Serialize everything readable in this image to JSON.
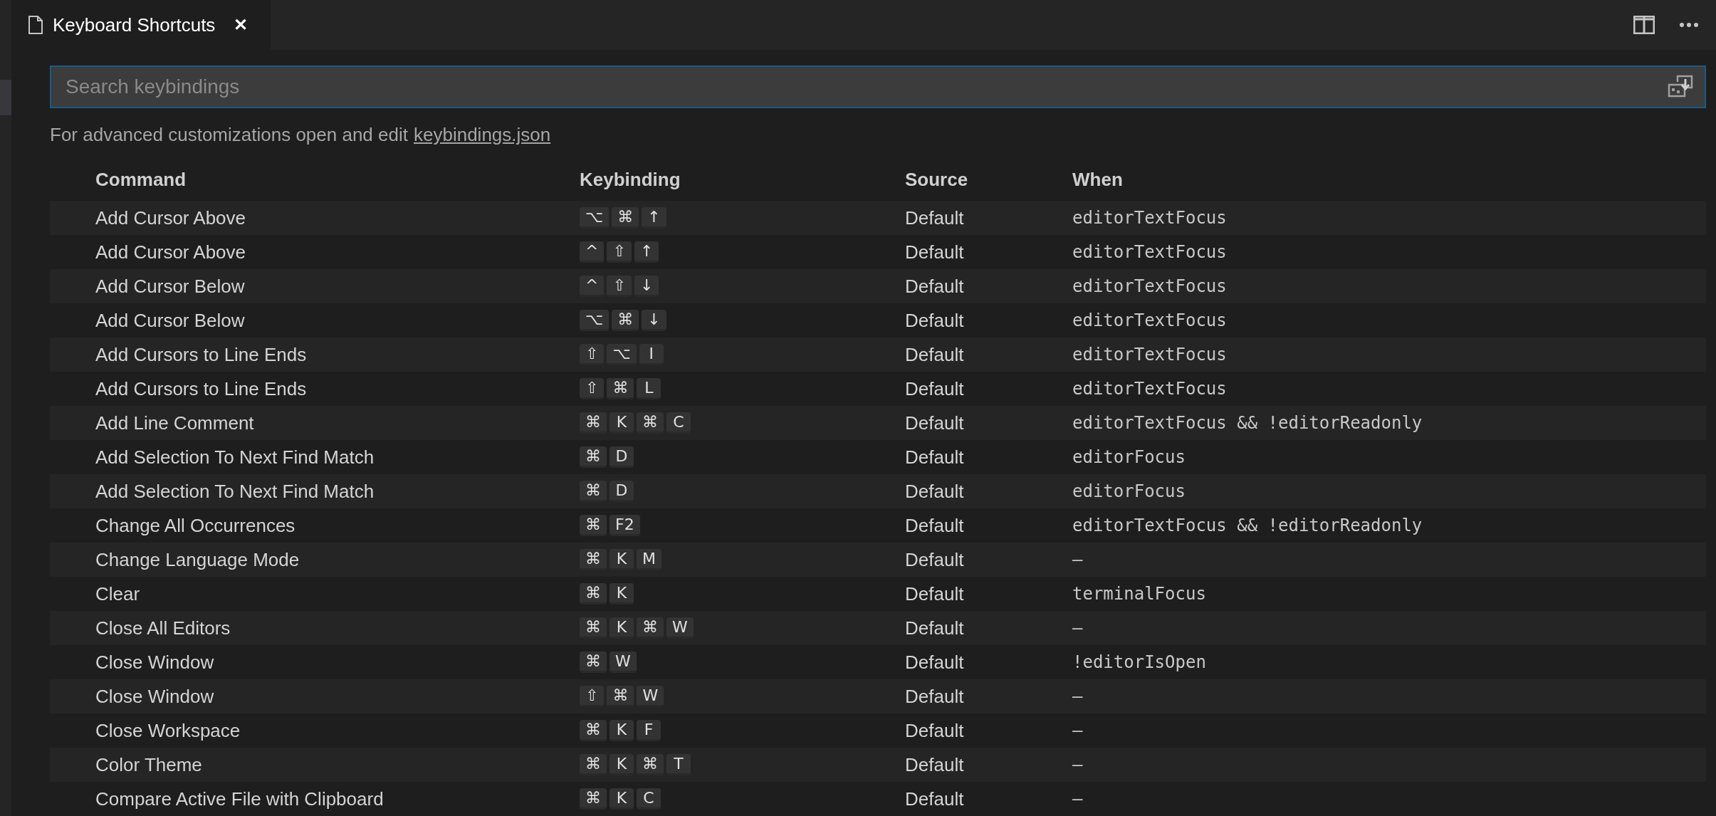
{
  "tab": {
    "title": "Keyboard Shortcuts",
    "close": "✕",
    "selected": true
  },
  "search": {
    "placeholder": "Search keybindings"
  },
  "help": {
    "text": "For advanced customizations open and edit",
    "link": "keybindings.json"
  },
  "table": {
    "columns": [
      "Command",
      "Keybinding",
      "Source",
      "When"
    ],
    "rows": [
      {
        "command": "Add Cursor Above",
        "keys": [
          "⌥",
          "⌘",
          "↑"
        ],
        "source": "Default",
        "when": "editorTextFocus"
      },
      {
        "command": "Add Cursor Above",
        "keys": [
          "^",
          "⇧",
          "↑"
        ],
        "source": "Default",
        "when": "editorTextFocus"
      },
      {
        "command": "Add Cursor Below",
        "keys": [
          "^",
          "⇧",
          "↓"
        ],
        "source": "Default",
        "when": "editorTextFocus"
      },
      {
        "command": "Add Cursor Below",
        "keys": [
          "⌥",
          "⌘",
          "↓"
        ],
        "source": "Default",
        "when": "editorTextFocus"
      },
      {
        "command": "Add Cursors to Line Ends",
        "keys": [
          "⇧",
          "⌥",
          "I"
        ],
        "source": "Default",
        "when": "editorTextFocus"
      },
      {
        "command": "Add Cursors to Line Ends",
        "keys": [
          "⇧",
          "⌘",
          "L"
        ],
        "source": "Default",
        "when": "editorTextFocus"
      },
      {
        "command": "Add Line Comment",
        "keys": [
          "⌘",
          "K",
          "⌘",
          "C"
        ],
        "source": "Default",
        "when": "editorTextFocus && !editorReadonly"
      },
      {
        "command": "Add Selection To Next Find Match",
        "keys": [
          "⌘",
          "D"
        ],
        "source": "Default",
        "when": "editorFocus"
      },
      {
        "command": "Add Selection To Next Find Match",
        "keys": [
          "⌘",
          "D"
        ],
        "source": "Default",
        "when": "editorFocus"
      },
      {
        "command": "Change All Occurrences",
        "keys": [
          "⌘",
          "F2"
        ],
        "source": "Default",
        "when": "editorTextFocus && !editorReadonly"
      },
      {
        "command": "Change Language Mode",
        "keys": [
          "⌘",
          "K",
          "M"
        ],
        "source": "Default",
        "when": "—"
      },
      {
        "command": "Clear",
        "keys": [
          "⌘",
          "K"
        ],
        "source": "Default",
        "when": "terminalFocus"
      },
      {
        "command": "Close All Editors",
        "keys": [
          "⌘",
          "K",
          "⌘",
          "W"
        ],
        "source": "Default",
        "when": "—"
      },
      {
        "command": "Close Window",
        "keys": [
          "⌘",
          "W"
        ],
        "source": "Default",
        "when": "!editorIsOpen"
      },
      {
        "command": "Close Window",
        "keys": [
          "⇧",
          "⌘",
          "W"
        ],
        "source": "Default",
        "when": "—"
      },
      {
        "command": "Close Workspace",
        "keys": [
          "⌘",
          "K",
          "F"
        ],
        "source": "Default",
        "when": "—"
      },
      {
        "command": "Color Theme",
        "keys": [
          "⌘",
          "K",
          "⌘",
          "T"
        ],
        "source": "Default",
        "when": "—"
      },
      {
        "command": "Compare Active File with Clipboard",
        "keys": [
          "⌘",
          "K",
          "C"
        ],
        "source": "Default",
        "when": "—"
      }
    ]
  }
}
